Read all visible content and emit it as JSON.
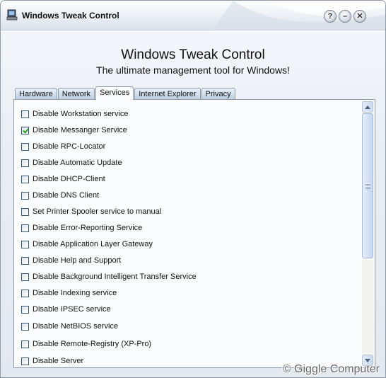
{
  "window": {
    "title": "Windows Tweak Control",
    "buttons": {
      "help": "?",
      "minimize": "–",
      "close": "✕"
    }
  },
  "header": {
    "title": "Windows Tweak Control",
    "subtitle": "The ultimate management tool for Windows!"
  },
  "tabs": [
    "Hardware",
    "Network",
    "Services",
    "Internet Explorer",
    "Privacy"
  ],
  "active_tab": "Services",
  "options": [
    {
      "label": "Disable Workstation service",
      "checked": false
    },
    {
      "label": "Disable Messanger Service",
      "checked": true
    },
    {
      "label": "Disable RPC-Locator",
      "checked": false
    },
    {
      "label": "Disable Automatic Update",
      "checked": false
    },
    {
      "label": "Disable DHCP-Client",
      "checked": false
    },
    {
      "label": "Disable DNS Client",
      "checked": false
    },
    {
      "label": "Set Printer Spooler service to manual",
      "checked": false
    },
    {
      "label": "Disable Error-Reporting Service",
      "checked": false
    },
    {
      "label": "Disable Application Layer Gateway",
      "checked": false
    },
    {
      "label": "Disable Help and Support",
      "checked": false
    },
    {
      "label": "Disable Background Intelligent Transfer Service",
      "checked": false
    },
    {
      "label": "Disable Indexing service",
      "checked": false
    },
    {
      "label": "Disable IPSEC service",
      "checked": false
    },
    {
      "label": "Disable NetBIOS service",
      "checked": false
    },
    {
      "label": "Disable  Remote-Registry (XP-Pro)",
      "checked": false
    },
    {
      "label": "Disable Server",
      "checked": false
    }
  ],
  "watermark": "© Giggle Computer"
}
